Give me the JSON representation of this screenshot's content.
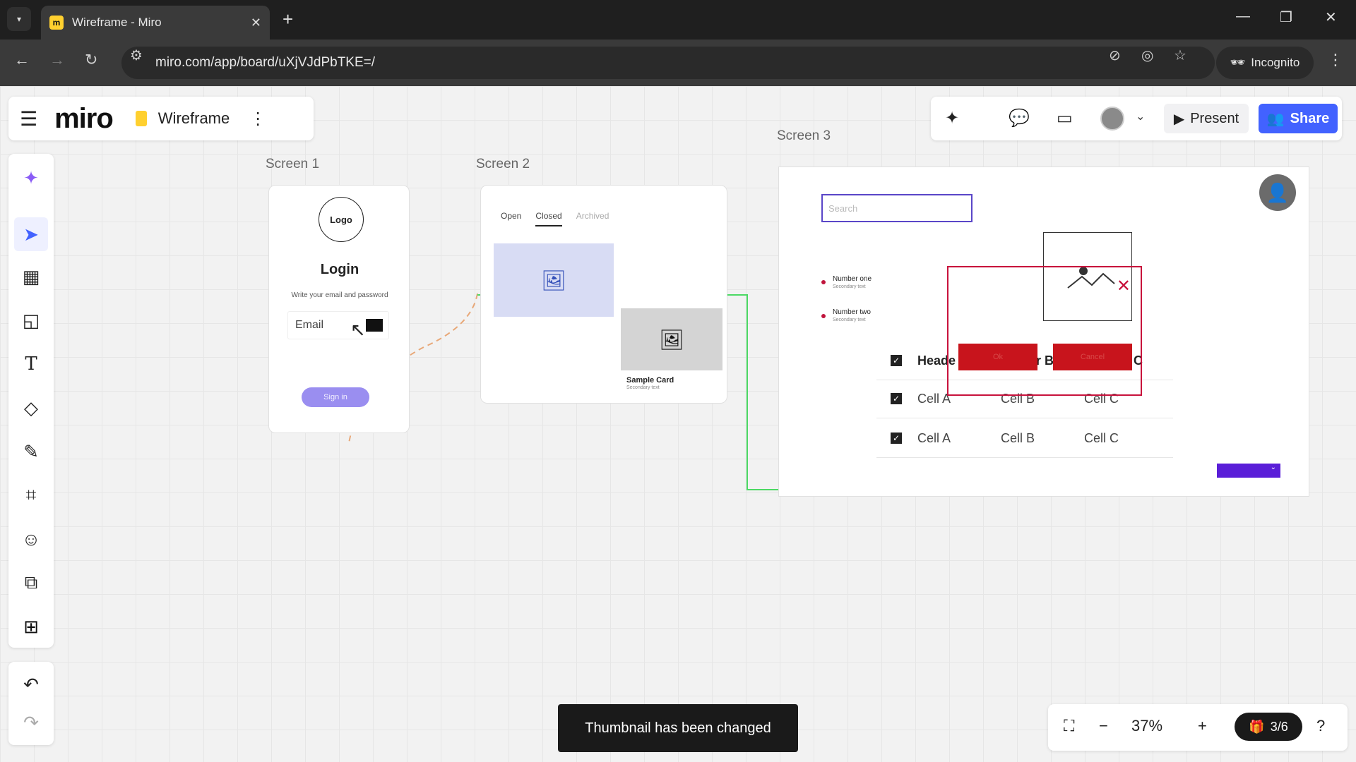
{
  "browser": {
    "tab_title": "Wireframe - Miro",
    "url": "miro.com/app/board/uXjVJdPbTKE=/",
    "incognito_label": "Incognito"
  },
  "board": {
    "name": "Wireframe",
    "logo": "miro",
    "present_label": "Present",
    "share_label": "Share"
  },
  "frames": {
    "screen1": {
      "label": "Screen 1",
      "logo_text": "Logo",
      "title": "Login",
      "subtitle": "Write your email and password",
      "email_placeholder": "Email",
      "signin_label": "Sign in"
    },
    "screen2": {
      "label": "Screen 2",
      "tabs": [
        "Open",
        "Closed",
        "Archived"
      ],
      "card_title": "Sample Card",
      "card_subtitle": "Secondary text"
    },
    "screen3": {
      "label": "Screen 3",
      "search_placeholder": "Search",
      "list": [
        {
          "title": "Number one",
          "subtitle": "Secondary text"
        },
        {
          "title": "Number two",
          "subtitle": "Secondary text"
        }
      ],
      "modal_ok": "Ok",
      "modal_cancel": "Cancel",
      "table_rows": [
        {
          "a": "Heade",
          "b": "r B",
          "c": "C"
        },
        {
          "a": "Cell A",
          "b": "Cell B",
          "c": "Cell C"
        },
        {
          "a": "Cell A",
          "b": "Cell B",
          "c": "Cell C"
        }
      ]
    }
  },
  "toast": "Thumbnail has been changed",
  "zoom": {
    "level": "37%",
    "page": "3/6"
  },
  "colors": {
    "share": "#4262ff",
    "connector_green": "#4cd964",
    "connector_orange": "#e8a878",
    "modal_red": "#c8123c"
  }
}
